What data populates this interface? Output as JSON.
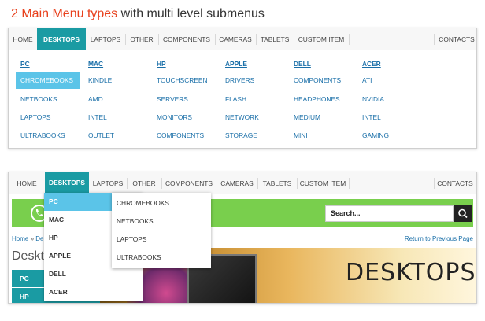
{
  "headline": {
    "accent": "2 Main Menu types",
    "rest": " with multi level submenus"
  },
  "menu1": {
    "items": [
      "HOME",
      "DESKTOPS",
      "LAPTOPS",
      "OTHER",
      "COMPONENTS",
      "CAMERAS",
      "TABLETS",
      "CUSTOM ITEM"
    ],
    "right": "CONTACTS",
    "active": "DESKTOPS"
  },
  "mega": {
    "columns": [
      {
        "head": "PC",
        "items": [
          "CHROMEBOOKS",
          "NETBOOKS",
          "LAPTOPS",
          "ULTRABOOKS"
        ]
      },
      {
        "head": "MAC",
        "items": [
          "KINDLE",
          "AMD",
          "INTEL",
          "OUTLET"
        ]
      },
      {
        "head": "HP",
        "items": [
          "TOUCHSCREEN",
          "SERVERS",
          "MONITORS",
          "COMPONENTS"
        ]
      },
      {
        "head": "APPLE",
        "items": [
          "DRIVERS",
          "FLASH",
          "NETWORK",
          "STORAGE"
        ]
      },
      {
        "head": "DELL",
        "items": [
          "COMPONENTS",
          "HEADPHONES",
          "MEDIUM",
          "MINI"
        ]
      },
      {
        "head": "ACER",
        "items": [
          "ATI",
          "NVIDIA",
          "INTEL",
          "GAMING"
        ]
      }
    ],
    "highlighted": "CHROMEBOOKS"
  },
  "menu2": {
    "items": [
      "HOME",
      "DESKTOPS",
      "LAPTOPS",
      "OTHER",
      "COMPONENTS",
      "CAMERAS",
      "TABLETS",
      "CUSTOM ITEM"
    ],
    "right": "CONTACTS",
    "active": "DESKTOPS"
  },
  "dropdown": {
    "level1": [
      "PC",
      "MAC",
      "HP",
      "APPLE",
      "DELL",
      "ACER"
    ],
    "level1_highlighted": "PC",
    "level2": [
      "CHROMEBOOKS",
      "NETBOOKS",
      "LAPTOPS",
      "ULTRABOOKS"
    ]
  },
  "search": {
    "placeholder": "Search..."
  },
  "breadcrumb": {
    "home": "Home",
    "sep": "»",
    "current": "De"
  },
  "return_link": "Return to Previous Page",
  "page_heading": "Deskto",
  "sidebar": [
    "PC",
    "HP"
  ],
  "banner": {
    "title": "DESKTOPS"
  },
  "colors": {
    "accent": "#1a9ba3",
    "highlight": "#5bc4e8",
    "link": "#1a6fa8",
    "green": "#79cf4d",
    "headline_accent": "#e8401c"
  },
  "icons": {
    "phone": "phone-icon",
    "search": "magnifier-icon"
  }
}
